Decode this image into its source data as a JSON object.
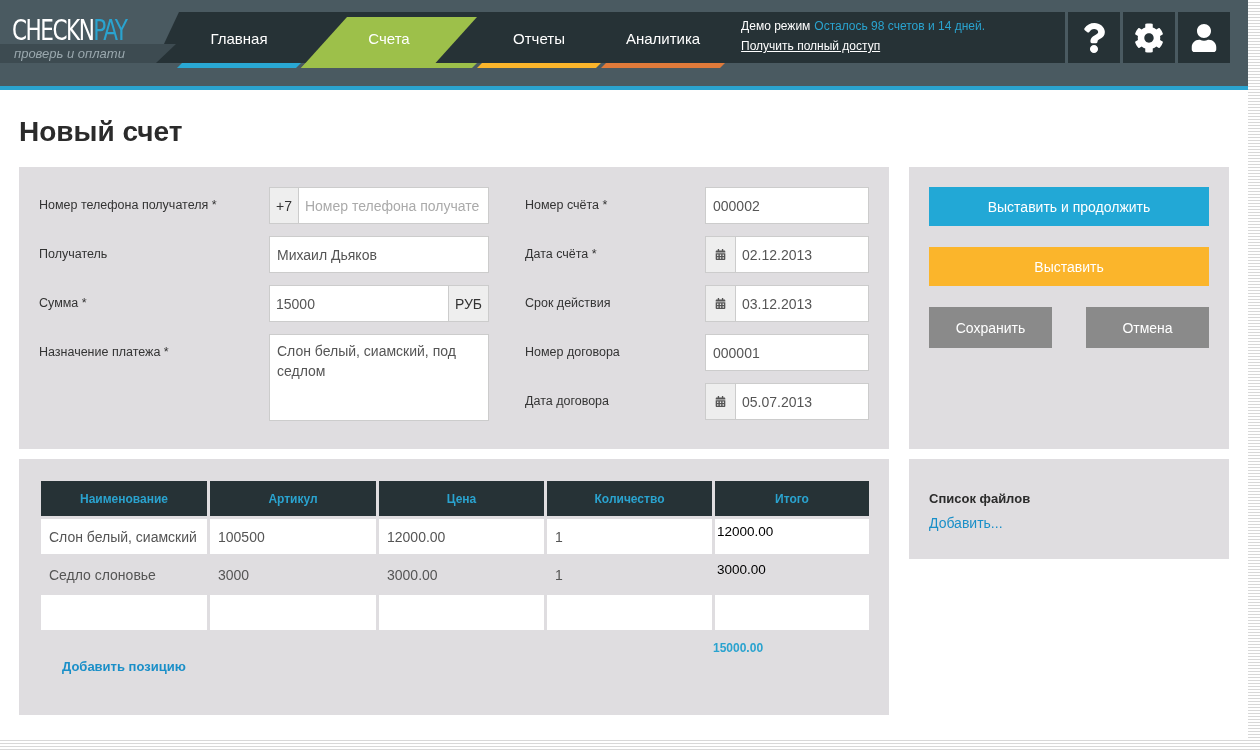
{
  "logo": {
    "name": "CHECKN",
    "accent": "PAY",
    "slogan": "проверь и оплати"
  },
  "nav": [
    {
      "label": "Главная",
      "color": "#29a8d4",
      "selected": false
    },
    {
      "label": "Счета",
      "color": "#9dc04a",
      "selected": true
    },
    {
      "label": "Отчеты",
      "color": "#fbb52b",
      "selected": false
    },
    {
      "label": "Аналитика",
      "color": "#e07a3a",
      "selected": false
    }
  ],
  "demo": {
    "label": "Демо режим",
    "remaining": "Осталось 98 счетов и 14 дней.",
    "link": "Получить полный доступ"
  },
  "toolbar": [
    {
      "kind": "help"
    },
    {
      "kind": "settings"
    },
    {
      "kind": "user"
    }
  ],
  "title": "Новый счет",
  "form": {
    "left": [
      {
        "kind": "phone",
        "label": "Номер телефона получателя *",
        "prefix": "+7",
        "placeholder": "Номер телефона получате"
      },
      {
        "kind": "text",
        "label": "Получатель",
        "value": "Михаил Дьяков"
      },
      {
        "kind": "amount",
        "label": "Сумма *",
        "value": "15000",
        "suffix": "РУБ"
      },
      {
        "kind": "textarea",
        "label": "Назначение платежа *",
        "value": "Слон белый, сиамский, под седлом"
      }
    ],
    "right": [
      {
        "kind": "text",
        "label": "Номер счёта *",
        "value": "000002"
      },
      {
        "kind": "date",
        "label": "Дата счёта *",
        "value": "02.12.2013"
      },
      {
        "kind": "date",
        "label": "Срок действия",
        "value": "03.12.2013"
      },
      {
        "kind": "text",
        "label": "Номер договора",
        "value": "000001"
      },
      {
        "kind": "date",
        "label": "Дата договора",
        "value": "05.07.2013"
      }
    ]
  },
  "actions": [
    {
      "kind": "primary",
      "label": "Выставить и продолжить"
    },
    {
      "kind": "warning",
      "label": "Выставить"
    },
    {
      "kind": "secondary",
      "label": "Сохранить"
    },
    {
      "kind": "secondary",
      "label": "Отмена"
    }
  ],
  "table": {
    "columns": [
      "Наименование",
      "Артикул",
      "Цена",
      "Количество",
      "Итого"
    ],
    "rows": [
      {
        "kind": "input",
        "cells": [
          "Слон белый, сиамский",
          "100500",
          "12000.00",
          "1",
          "12000.00"
        ]
      },
      {
        "kind": "text",
        "cells": [
          "Седло слоновье",
          "3000",
          "3000.00",
          "1",
          "3000.00"
        ]
      },
      {
        "kind": "input"
      }
    ],
    "total": "15000.00",
    "add_link": "Добавить позицию"
  },
  "files": {
    "title": "Список файлов",
    "add_link": "Добавить..."
  }
}
